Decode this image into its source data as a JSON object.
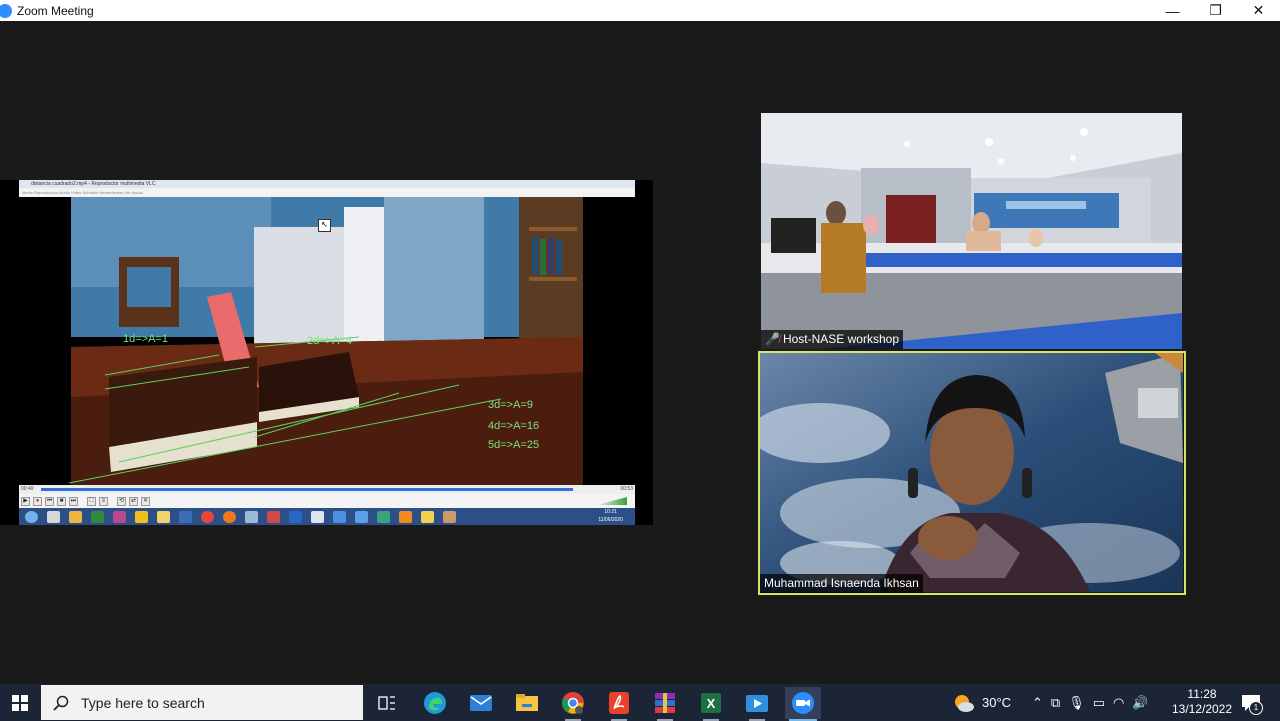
{
  "window": {
    "title": "Zoom Meeting",
    "minimize": "—",
    "restore": "❐",
    "close": "✕"
  },
  "shared_screen": {
    "vlc_title": "distancia cuadrado2.mp4 - Reproductor multimedia VLC",
    "vlc_menu": "Medio   Reproducción   Audio   Vídeo   Subtítulo   Herramientas   Ver   Ayuda",
    "annotations": [
      "1d=>A=1",
      "2d=>A=4",
      "3d=>A=9",
      "4d=>A=16",
      "5d=>A=25"
    ],
    "time_elapsed": "00:49",
    "time_total": "00:53",
    "progress": 0.95,
    "clock_time": "10:21",
    "clock_date": "11/06/2020"
  },
  "participants": [
    {
      "name": "Host-NASE workshop",
      "muted": true
    },
    {
      "name": "Muhammad Isnaenda Ikhsan",
      "muted": false,
      "active_speaker": true
    }
  ],
  "taskbar": {
    "search_placeholder": "Type here to search",
    "apps": [
      "task-view",
      "edge",
      "mail",
      "file-explorer",
      "chrome",
      "acrobat",
      "winrar",
      "excel",
      "powerpoint",
      "zoom"
    ],
    "weather_temp": "30°C",
    "time": "11:28",
    "date": "13/12/2022",
    "notification_count": "1"
  },
  "colors": {
    "accent_zoom": "#2d8cff",
    "active_speaker_border": "#d8e36b",
    "taskbar_bg": "#1c2536"
  }
}
